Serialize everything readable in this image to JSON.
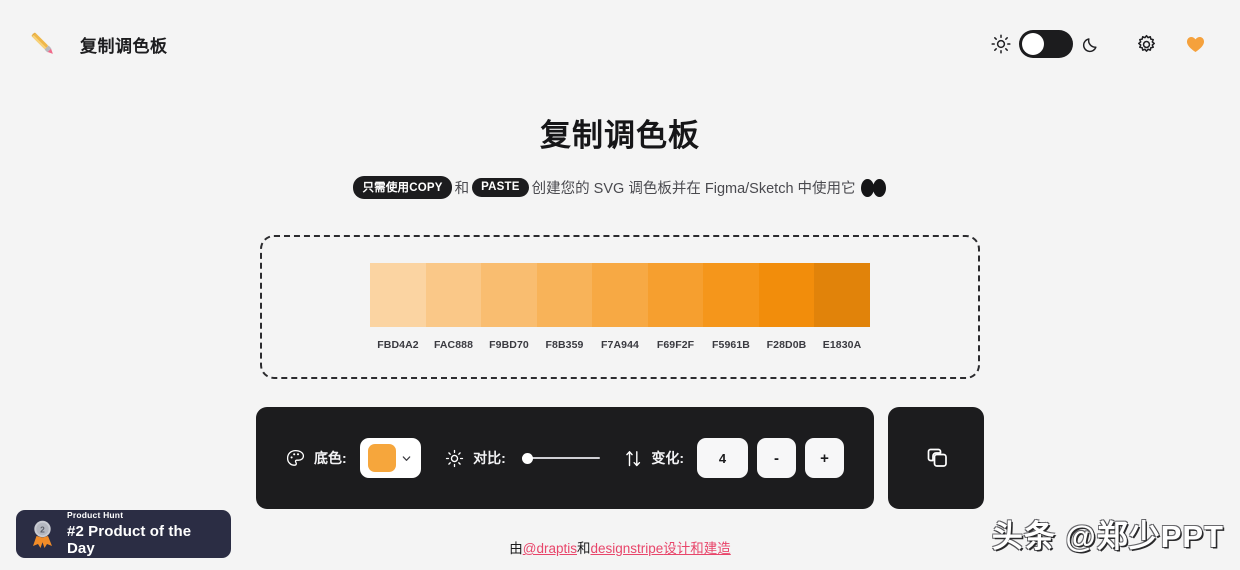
{
  "header": {
    "brand_icon": "paintbrush-icon",
    "brand_title": "复制调色板",
    "sun_icon": "sun-icon",
    "moon_icon": "moon-icon",
    "theme_toggle_state": "light",
    "gear_icon": "gear-icon",
    "heart_icon": "heart-icon",
    "heart_color": "#F5A13C"
  },
  "hero": {
    "title": "复制调色板",
    "subtitle_kbd_1": "只需使用COPY",
    "subtitle_text_1": "和",
    "subtitle_kbd_2": "PASTE",
    "subtitle_text_2": "创建您的 SVG 调色板并在 Figma/Sketch 中使用它"
  },
  "palette": {
    "swatches": [
      {
        "hex": "FBD4A2",
        "color": "#FBD4A2"
      },
      {
        "hex": "FAC888",
        "color": "#FAC888"
      },
      {
        "hex": "F9BD70",
        "color": "#F9BD70"
      },
      {
        "hex": "F8B359",
        "color": "#F8B359"
      },
      {
        "hex": "F7A944",
        "color": "#F7A944"
      },
      {
        "hex": "F69F2F",
        "color": "#F69F2F"
      },
      {
        "hex": "F5961B",
        "color": "#F5961B"
      },
      {
        "hex": "F28D0B",
        "color": "#F28D0B"
      },
      {
        "hex": "E1830A",
        "color": "#E1830A"
      }
    ]
  },
  "controls": {
    "palette_icon": "palette-icon",
    "base_color_label": "底色:",
    "base_color_value": "#F6A63C",
    "chevron_icon": "chevron-down-icon",
    "contrast_icon": "brightness-icon",
    "contrast_label": "对比:",
    "contrast_value": 0,
    "variations_icon": "sort-arrows-icon",
    "variations_label": "变化:",
    "variations_value": "4",
    "decrement_label": "-",
    "increment_label": "+",
    "copy_icon": "copy-icon"
  },
  "footer": {
    "prefix": "由",
    "link_1": "@draptis",
    "middle": "和",
    "link_2": "designstripe",
    "suffix": "设计和建造"
  },
  "product_hunt": {
    "medal_icon": "medal-icon",
    "medal_rank": "2",
    "top_label": "Product Hunt",
    "main_label": "#2 Product of the Day"
  },
  "watermark": {
    "text": "头条 @郑少PPT"
  }
}
